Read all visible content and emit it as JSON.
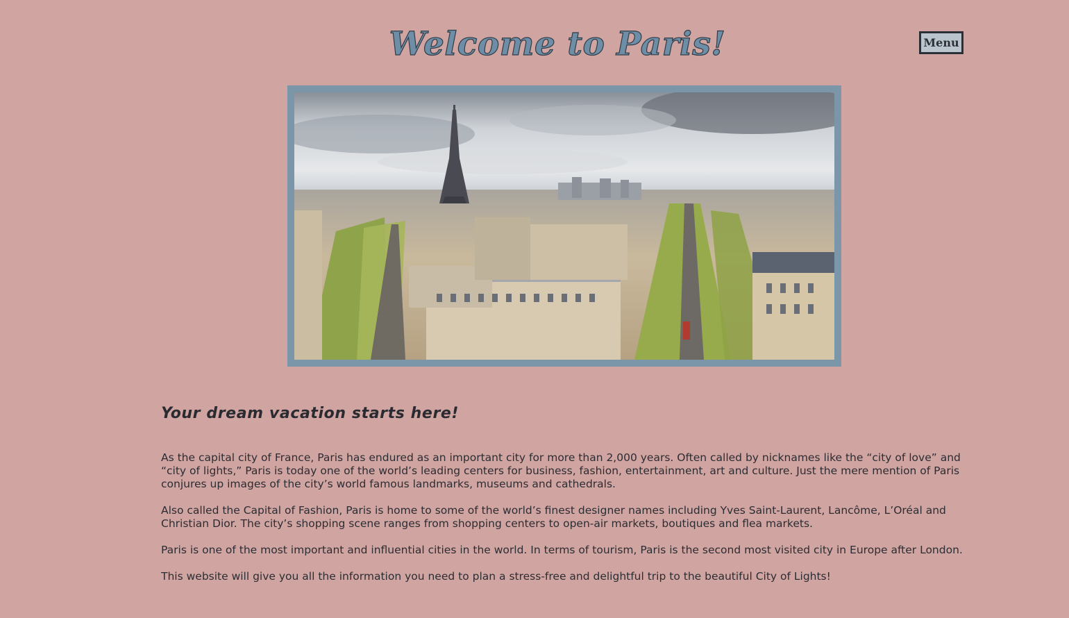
{
  "header": {
    "title": "Welcome to Paris!",
    "menu_label": "Menu"
  },
  "hero": {
    "image_subject": "Panoramic view of Paris with the Eiffel Tower and tree-lined avenues",
    "frame_color": "#7b96a8"
  },
  "main": {
    "tagline": "Your dream vacation starts here!",
    "paragraphs": [
      "As the capital city of France, Paris has endured as an important city for more than 2,000 years. Often called by nicknames like the “city of love” and “city of lights,” Paris is today one of the world’s leading centers for business, fashion, entertainment, art and culture. Just the mere mention of Paris conjures up images of the city’s world famous landmarks, museums and cathedrals.",
      "Also called the Capital of Fashion, Paris is home to some of the world’s finest designer names including Yves Saint-Laurent, Lancôme, L’Oréal and Christian Dior. The city’s shopping scene ranges from shopping centers to open-air markets, boutiques and flea markets.",
      "Paris is one of the most important and influential cities in the world. In terms of tourism, Paris is the second most visited city in Europe after London.",
      "This website will give you all the information you need to plan a stress-free and delightful trip to the beautiful City of Lights!"
    ]
  },
  "colors": {
    "background": "#d0a5a1",
    "title_fill": "#6d8ea6",
    "menu_bg": "#b9c4cc",
    "text": "#2c2c33"
  }
}
